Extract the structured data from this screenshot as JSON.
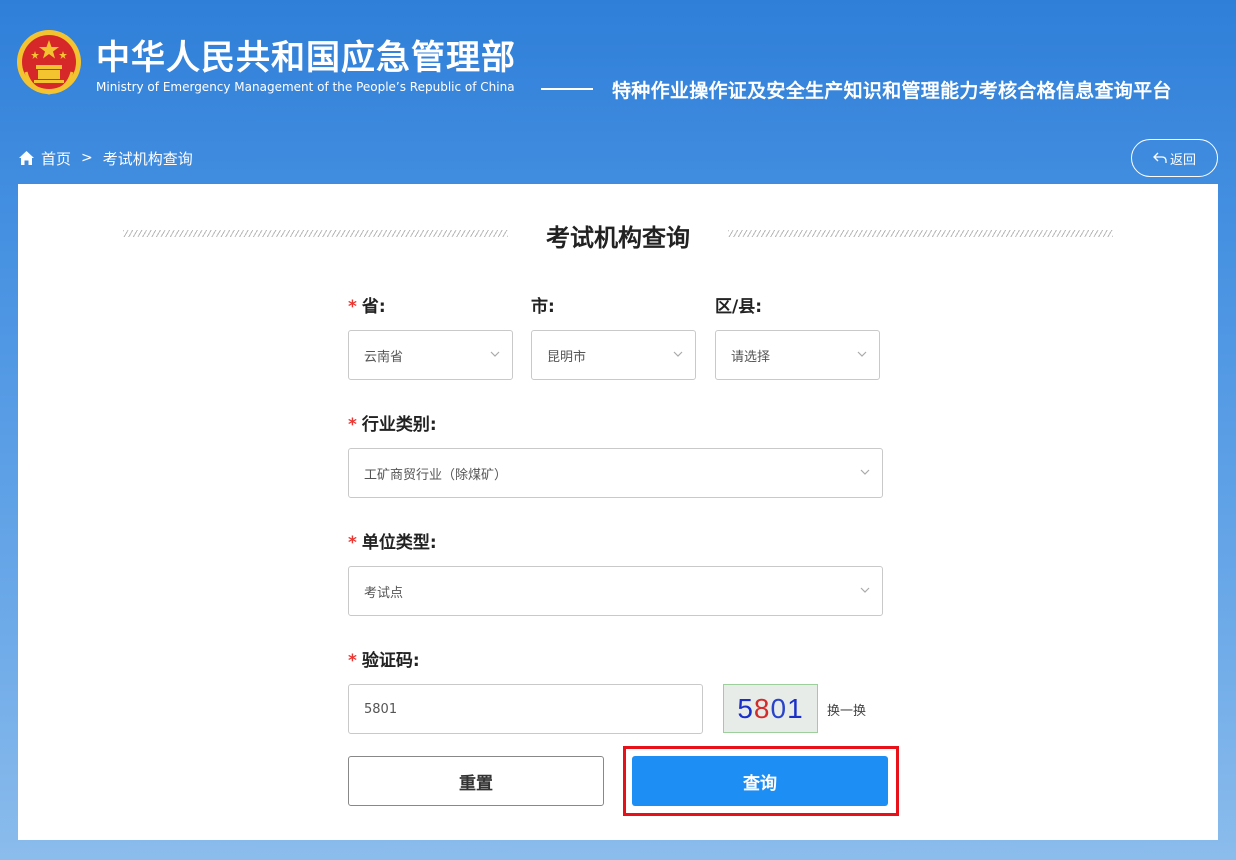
{
  "header": {
    "ministry_cn": "中华人民共和国应急管理部",
    "ministry_en": "Ministry of Emergency Management of the People’s Republic of China",
    "platform_title": "特种作业操作证及安全生产知识和管理能力考核合格信息查询平台",
    "emblem_icon": "national-emblem-icon"
  },
  "breadcrumb": {
    "home_label": "首页",
    "separator": ">",
    "current_label": "考试机构查询"
  },
  "back_button": {
    "label": "返回",
    "icon": "return-arrow-icon"
  },
  "card": {
    "title": "考试机构查询"
  },
  "form": {
    "required_mark": "*",
    "province": {
      "label": "省:",
      "value": "云南省"
    },
    "city": {
      "label": "市:",
      "value": "昆明市"
    },
    "district": {
      "label": "区/县:",
      "value": "请选择"
    },
    "industry": {
      "label": "行业类别:",
      "value": "工矿商贸行业（除煤矿）"
    },
    "unit_type": {
      "label": "单位类型:",
      "value": "考试点"
    },
    "captcha": {
      "label": "验证码:",
      "value": "5801",
      "image_digits": [
        "5",
        "8",
        "0",
        "1"
      ],
      "refresh_label": "换一换"
    },
    "reset_label": "重置",
    "query_label": "查询"
  },
  "colors": {
    "primary": "#1d8ef4",
    "required": "#e53935",
    "highlight": "#e8111a"
  }
}
